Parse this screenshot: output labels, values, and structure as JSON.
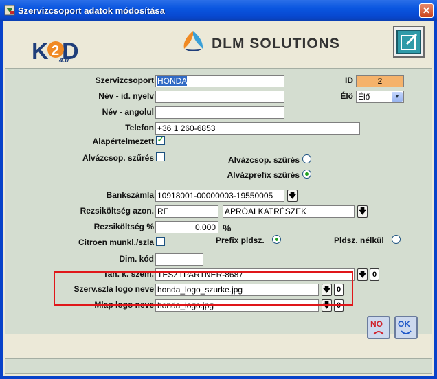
{
  "window": {
    "title": "Szervizcsoport adatok módosítása",
    "close_label": "✕"
  },
  "logo": {
    "product": "K2D",
    "version": "4.0",
    "company": "DLM SOLUTIONS"
  },
  "form": {
    "szervizcsoport": {
      "label": "Szervizcsoport",
      "value": "HONDA"
    },
    "id": {
      "label": "ID",
      "value": "2"
    },
    "nev_id_nyelv": {
      "label": "Név - id. nyelv",
      "value": ""
    },
    "elo": {
      "label": "Élő",
      "value": "Élő"
    },
    "nev_angolul": {
      "label": "Név - angolul",
      "value": ""
    },
    "telefon": {
      "label": "Telefon",
      "value": "+36 1 260-6853"
    },
    "alapertelmezett": {
      "label": "Alapértelmezett",
      "checked": true
    },
    "alvazcsop_szures_chk": {
      "label": "Alvázcsop. szűrés",
      "checked": false
    },
    "alvazcsop_szures_radio": {
      "label": "Alvázcsop. szűrés",
      "selected": false
    },
    "alvazprefix_szures_radio": {
      "label": "Alvázprefix szűrés",
      "selected": true
    },
    "bankszamla": {
      "label": "Bankszámla",
      "value": "10918001-00000003-19550005"
    },
    "rezsikoltseg_azon": {
      "label": "Rezsiköltség azon.",
      "code": "RE",
      "name": "APRÓALKATRÉSZEK"
    },
    "rezsikoltseg_pct": {
      "label": "Rezsiköltség %",
      "value": "0,000",
      "unit": "%"
    },
    "citroen": {
      "label": "Citroen munkl./szla",
      "checked": false
    },
    "prefix_pldsz": {
      "label": "Prefix pldsz.",
      "selected": true
    },
    "pldsz_nelkul": {
      "label": "Pldsz. nélkül",
      "selected": false
    },
    "dim_kod": {
      "label": "Dim. kód",
      "value": ""
    },
    "tan_k_szem": {
      "label": "Tan. k. szem.",
      "value": "TESZTPARTNER-8687",
      "zero": "0"
    },
    "szerv_szla_logo": {
      "label": "Szerv.szla logo neve",
      "value": "honda_logo_szurke.jpg",
      "zero": "0"
    },
    "mlap_logo": {
      "label": "Mlap logo neve",
      "value": "honda_logo.jpg",
      "zero": "0"
    }
  },
  "buttons": {
    "no_label": "NO",
    "ok_label": "OK"
  },
  "colors": {
    "titlebar": "#0a56e0",
    "panel": "#d4ddd0",
    "id_bg": "#f5b26b",
    "highlight": "#e0171a"
  }
}
